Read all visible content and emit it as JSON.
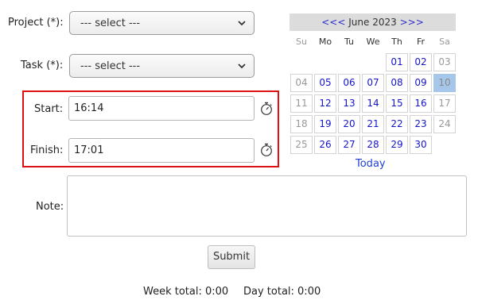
{
  "form": {
    "project_label": "Project (*):",
    "project_value": "--- select ---",
    "task_label": "Task (*):",
    "task_value": "--- select ---",
    "start_label": "Start:",
    "start_value": "16:14",
    "finish_label": "Finish:",
    "finish_value": "17:01",
    "note_label": "Note:",
    "note_value": "",
    "submit_label": "Submit",
    "highlight_color": "#dd1111"
  },
  "calendar": {
    "prev_label": "<<<",
    "month_label": "June 2023",
    "next_label": ">>>",
    "weekdays": [
      "Su",
      "Mo",
      "Tu",
      "We",
      "Th",
      "Fr",
      "Sa"
    ],
    "weeks": [
      [
        "",
        "",
        "",
        "",
        "01",
        "02",
        "03"
      ],
      [
        "04",
        "05",
        "06",
        "07",
        "08",
        "09",
        "10"
      ],
      [
        "11",
        "12",
        "13",
        "14",
        "15",
        "16",
        "17"
      ],
      [
        "18",
        "19",
        "20",
        "21",
        "22",
        "23",
        "24"
      ],
      [
        "25",
        "26",
        "27",
        "28",
        "29",
        "30",
        ""
      ]
    ],
    "selected_day": "10",
    "today_label": "Today",
    "link_color": "#1515c8",
    "selected_color": "#a7c7ea"
  },
  "totals": {
    "week_text": "Week total: 0:00",
    "day_text": "Day total: 0:00"
  }
}
